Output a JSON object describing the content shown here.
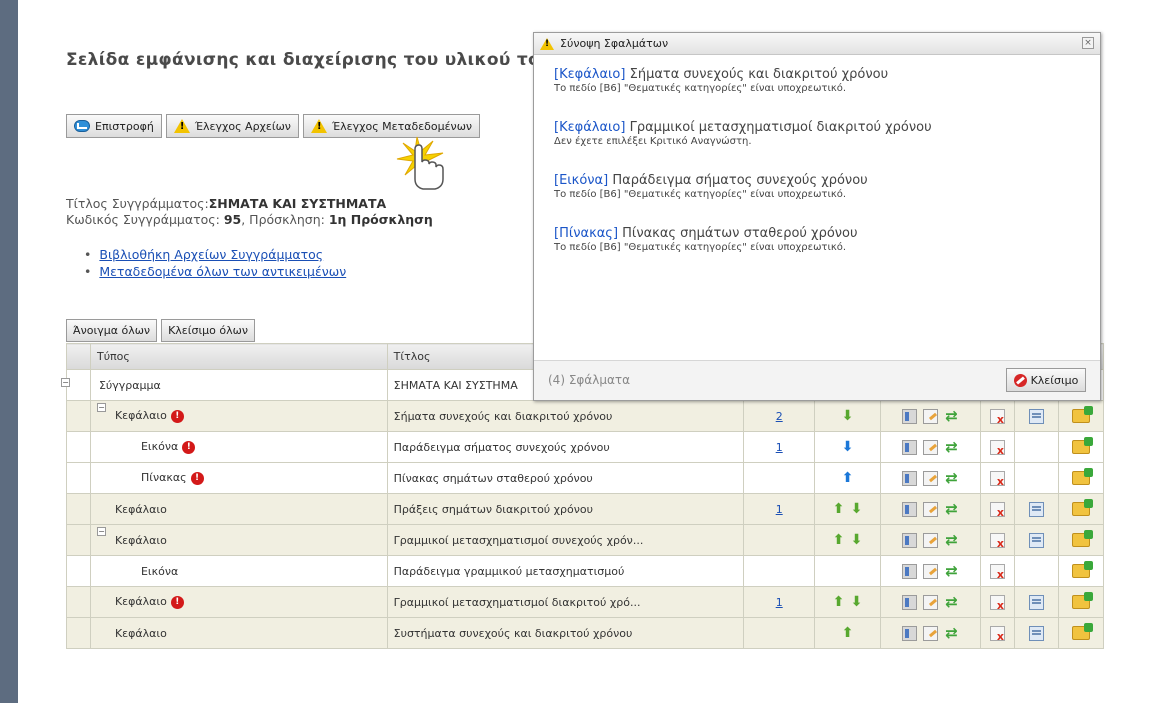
{
  "page_title": "Σελίδα εμφάνισης και διαχείρισης του υλικού το",
  "toolbar": {
    "return_label": "Επιστροφή",
    "check_files_label": "Έλεγχος Αρχείων",
    "check_metadata_label": "Έλεγχος Μεταδεδομένων"
  },
  "book": {
    "title_label": "Τίτλος Συγγράμματος:",
    "title_value": "ΣΗΜΑΤΑ ΚΑΙ ΣΥΣΤΗΜΑΤΑ",
    "code_label": "Κωδικός Συγγράμματος:",
    "code_value": "95",
    "invitation_label": ", Πρόσκληση:",
    "invitation_value": "1η Πρόσκληση"
  },
  "links": [
    "Βιβλιοθήκη Αρχείων Συγγράμματος",
    "Μεταδεδομένα όλων των αντικειμένων"
  ],
  "tree_controls": {
    "open_all": "Άνοιγμα όλων",
    "close_all": "Κλείσιμο όλων"
  },
  "table": {
    "headers": {
      "type": "Τύπος",
      "title": "Τίτλος"
    },
    "rows": [
      {
        "type": "Σύγγραμμα",
        "title": "ΣΗΜΑΤΑ ΚΑΙ ΣΥΣΤΗΜΑ",
        "count": ""
      },
      {
        "type": "Κεφάλαιο",
        "title": "Σήματα συνεχούς και διακριτού χρόνου",
        "count": "2"
      },
      {
        "type": "Εικόνα",
        "title": "Παράδειγμα σήματος συνεχούς χρόνου",
        "count": "1"
      },
      {
        "type": "Πίνακας",
        "title": "Πίνακας σημάτων σταθερού χρόνου",
        "count": ""
      },
      {
        "type": "Κεφάλαιο",
        "title": "Πράξεις σημάτων διακριτού χρόνου",
        "count": "1"
      },
      {
        "type": "Κεφάλαιο",
        "title": "Γραμμικοί μετασχηματισμοί συνεχούς χρόν...",
        "count": ""
      },
      {
        "type": "Εικόνα",
        "title": "Παράδειγμα γραμμικού μετασχηματισμού",
        "count": ""
      },
      {
        "type": "Κεφάλαιο",
        "title": "Γραμμικοί μετασχηματισμοί διακριτού χρό...",
        "count": "1"
      },
      {
        "type": "Κεφάλαιο",
        "title": "Συστήματα συνεχούς και διακριτού χρόνου",
        "count": ""
      }
    ]
  },
  "error_dialog": {
    "title": "Σύνοψη Σφαλμάτων",
    "errors": [
      {
        "tag": "[Κεφάλαιο]",
        "name": "Σήματα συνεχούς και διακριτού χρόνου",
        "message": "Το πεδίο [Β6] \"Θεματικές κατηγορίες\" είναι υποχρεωτικό."
      },
      {
        "tag": "[Κεφάλαιο]",
        "name": "Γραμμικοί μετασχηματισμοί διακριτού χρόνου",
        "message": "Δεν έχετε επιλέξει Κριτικό Αναγνώστη."
      },
      {
        "tag": "[Εικόνα]",
        "name": "Παράδειγμα σήματος συνεχούς χρόνου",
        "message": "Το πεδίο [Β6] \"Θεματικές κατηγορίες\" είναι υποχρεωτικό."
      },
      {
        "tag": "[Πίνακας]",
        "name": "Πίνακας σημάτων σταθερού χρόνου",
        "message": "Το πεδίο [Β6] \"Θεματικές κατηγορίες\" είναι υποχρεωτικό."
      }
    ],
    "count_label": "(4) Σφάλματα",
    "close_label": "Κλείσιμο"
  }
}
